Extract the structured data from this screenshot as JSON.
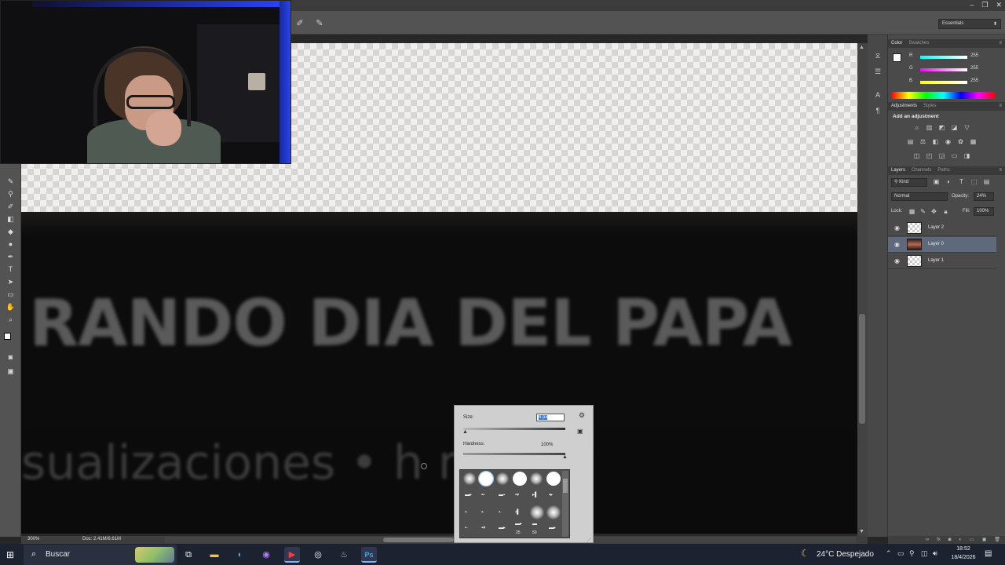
{
  "window": {
    "controls": [
      "–",
      "❐",
      "✕"
    ]
  },
  "options_bar": {
    "workspace": "Essentials",
    "icons": [
      "airbrush-icon",
      "pressure-icon"
    ]
  },
  "canvas": {
    "title_text": "RANDO DIA DEL PAPA",
    "subtitle_text": "sualizaciones • h    meses"
  },
  "status": {
    "zoom": "300%",
    "doc": "Doc: 2.41M/6.61M"
  },
  "panels": {
    "color_tabs": [
      "Color",
      "Swatches"
    ],
    "color": {
      "r_label": "R",
      "r_value": "255",
      "g_label": "G",
      "g_value": "255",
      "b_label": "B",
      "b_value": "255"
    },
    "adjustment_tabs": [
      "Adjustments",
      "Styles"
    ],
    "adjustment_title": "Add an adjustment",
    "layers_tabs": [
      "Layers",
      "Channels",
      "Paths"
    ],
    "layers": {
      "kind": "Kind",
      "blend_mode": "Normal",
      "opacity_label": "Opacity:",
      "opacity_value": "24%",
      "lock_label": "Lock:",
      "fill_label": "Fill:",
      "fill_value": "100%",
      "items": [
        {
          "name": "Layer 2"
        },
        {
          "name": "Layer 0"
        },
        {
          "name": "Layer 1"
        }
      ]
    }
  },
  "brush_picker": {
    "size_label": "Size:",
    "size_value": "4 px",
    "hardness_label": "Hardness:",
    "hardness_value": "100%",
    "preset_numbers": [
      "25",
      "50"
    ]
  },
  "taskbar": {
    "search_placeholder": "Buscar",
    "weather": "24°C  Despejado",
    "time": "18:52",
    "date": "18/4/2026"
  },
  "colors": {
    "accent": "#3875d7",
    "selected_layer": "#5e6a7c",
    "webcam_light": "#2847ff"
  }
}
